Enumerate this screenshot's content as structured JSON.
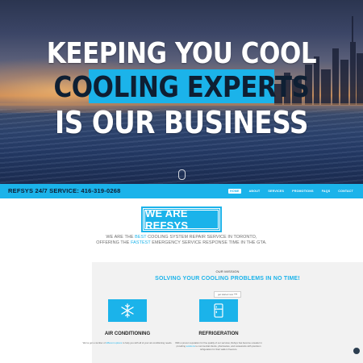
{
  "hero": {
    "line1": "KEEPING YOU COOL",
    "line2": "COOLING EXPERTS",
    "line3": "IS OUR BUSINESS"
  },
  "navbar": {
    "brand": "REFSYS 24/7 SERVICE: 416-319-0268",
    "links": [
      "HOME",
      "ABOUT",
      "SERVICES",
      "PROMOTIONS",
      "FAQS",
      "CONTACT"
    ]
  },
  "intro": {
    "badge": "WE ARE REFSYS",
    "line1_pre": "WE ARE THE ",
    "line1_hl": "BEST",
    "line1_post": " COOLING SYSTEM REPAIR SERVICE IN TORONTO,",
    "line2_pre": "OFFERING THE ",
    "line2_hl": "FASTEST",
    "line2_post": " EMERGENCY SERVICE RESPONSE TIME IN THE GTA."
  },
  "mission": {
    "label": "OUR MISSION",
    "title": "SOLVING YOUR COOLING PROBLEMS IN NO TIME!",
    "small": "get started now ⟶"
  },
  "cards": [
    {
      "title": "AIR CONDITIONING",
      "text_pre": "We've got a number of ",
      "text_hl": "different options",
      "text_post": " to help you with all of your air-conditioning needs.",
      "icon": "snowflake-icon"
    },
    {
      "title": "REFRIGERATION",
      "text_pre": "With a proven reputation for fine quality of our services, Refsys has become a leader in providing ",
      "text_hl": "solutions",
      "text_post": " to commercial clients, pharmacies, and restaurants with precision refrigeration for their walk-in freezers.",
      "icon": "fridge-icon"
    }
  ],
  "colors": {
    "accent": "#1bb3ea",
    "nav_text": "#0d1e33"
  }
}
